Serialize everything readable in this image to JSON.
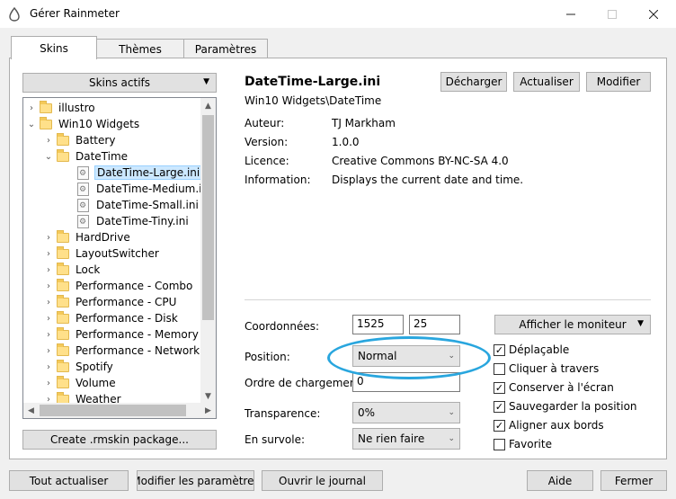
{
  "window": {
    "title": "Gérer Rainmeter"
  },
  "tabs": [
    {
      "label": "Skins"
    },
    {
      "label": "Thèmes"
    },
    {
      "label": "Paramètres"
    }
  ],
  "skins_panel": {
    "active_skins_label": "Skins actifs",
    "create_button": "Create .rmskin package...",
    "tree": [
      {
        "label": "illustro",
        "expander": "›"
      },
      {
        "label": "Win10 Widgets",
        "expander": "⌄"
      },
      {
        "label": "Battery",
        "expander": "›"
      },
      {
        "label": "DateTime",
        "expander": "⌄"
      },
      {
        "label": "DateTime-Large.ini"
      },
      {
        "label": "DateTime-Medium.ini"
      },
      {
        "label": "DateTime-Small.ini"
      },
      {
        "label": "DateTime-Tiny.ini"
      },
      {
        "label": "HardDrive",
        "expander": "›"
      },
      {
        "label": "LayoutSwitcher",
        "expander": "›"
      },
      {
        "label": "Lock",
        "expander": "›"
      },
      {
        "label": "Performance - Combo",
        "expander": "›"
      },
      {
        "label": "Performance - CPU",
        "expander": "›"
      },
      {
        "label": "Performance - Disk",
        "expander": "›"
      },
      {
        "label": "Performance - Memory",
        "expander": "›"
      },
      {
        "label": "Performance - Network",
        "expander": "›"
      },
      {
        "label": "Spotify",
        "expander": "›"
      },
      {
        "label": "Volume",
        "expander": "›"
      },
      {
        "label": "Weather",
        "expander": "›"
      }
    ]
  },
  "details": {
    "skin_name": "DateTime-Large.ini",
    "skin_path": "Win10 Widgets\\DateTime",
    "buttons": {
      "unload": "Décharger",
      "refresh": "Actualiser",
      "edit": "Modifier"
    },
    "info": [
      {
        "key": "Auteur:",
        "value": "TJ Markham"
      },
      {
        "key": "Version:",
        "value": "1.0.0"
      },
      {
        "key": "Licence:",
        "value": "Creative Commons BY-NC-SA 4.0"
      },
      {
        "key": "Information:",
        "value": "Displays the current date and time."
      }
    ]
  },
  "settings": {
    "coords_label": "Coordonnées:",
    "coord_x": "1525",
    "coord_y": "25",
    "position_label": "Position:",
    "position_value": "Normal",
    "load_order_label": "Ordre de chargement:",
    "load_order_value": "0",
    "transparency_label": "Transparence:",
    "transparency_value": "0%",
    "hover_label": "En survole:",
    "hover_value": "Ne rien faire",
    "monitor_button": "Afficher le moniteur",
    "checkboxes": [
      {
        "label": "Déplaçable",
        "checked": true,
        "mark": "✓"
      },
      {
        "label": "Cliquer à travers",
        "checked": false,
        "mark": ""
      },
      {
        "label": "Conserver à l'écran",
        "checked": true,
        "mark": "✓"
      },
      {
        "label": "Sauvegarder la position",
        "checked": true,
        "mark": "✓"
      },
      {
        "label": "Aligner aux bords",
        "checked": true,
        "mark": "✓"
      },
      {
        "label": "Favorite",
        "checked": false,
        "mark": ""
      }
    ]
  },
  "footer": {
    "refresh_all": "Tout actualiser",
    "edit_settings": "Modifier les paramètres",
    "open_log": "Ouvrir le journal",
    "help": "Aide",
    "close": "Fermer"
  },
  "colors": {
    "accent_highlight": "#29a6de",
    "selection": "#cce8ff"
  }
}
